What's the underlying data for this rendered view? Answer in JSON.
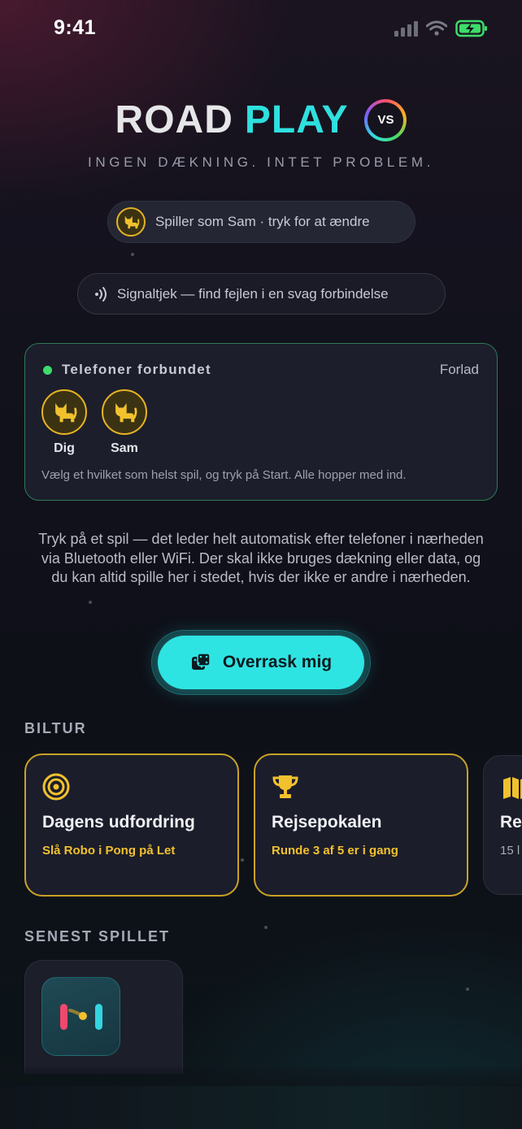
{
  "status_bar": {
    "time": "9:41"
  },
  "header": {
    "title_road": "ROAD",
    "title_play": "PLAY",
    "badge": "VS",
    "subtitle": "INGEN DÆKNING. INTET PROBLEM."
  },
  "player_pill": {
    "label": "Spiller som Sam · tryk for at ændre"
  },
  "signal_pill": {
    "label": "Signaltjek — find fejlen i en svag forbindelse"
  },
  "connection": {
    "title": "Telefoner forbundet",
    "leave_label": "Forlad",
    "players": [
      {
        "name": "Dig"
      },
      {
        "name": "Sam"
      }
    ],
    "note": "Vælg et hvilket som helst spil, og tryk på Start. Alle hopper med ind."
  },
  "description": "Tryk på et spil — det leder helt automatisk efter telefoner i nærheden via Bluetooth eller WiFi. Der skal ikke bruges dækning eller data, og du kan altid spille her i stedet, hvis der ikke er andre i nærheden.",
  "surprise_button": {
    "label": "Overrask mig"
  },
  "road_trip": {
    "section_title": "BILTUR",
    "cards": [
      {
        "title": "Dagens udfordring",
        "subtitle": "Slå Robo i Pong på Let",
        "icon": "target-icon"
      },
      {
        "title": "Rejsepokalen",
        "subtitle": "Runde 3 af 5 er i gang",
        "icon": "trophy-icon"
      },
      {
        "title": "Re",
        "subtitle": "15 l",
        "icon": "map-icon"
      }
    ]
  },
  "recent": {
    "section_title": "SENEST SPILLET",
    "items": [
      {
        "icon": "pong-game-icon"
      }
    ]
  },
  "colors": {
    "accent": "#2ee0df",
    "gold": "#f2c12e",
    "connected_green": "#3ddc6b"
  }
}
